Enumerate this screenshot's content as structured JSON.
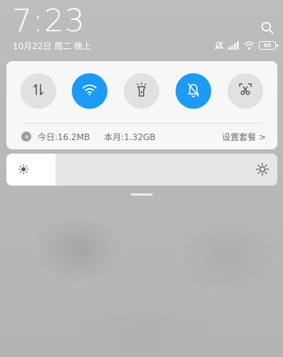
{
  "status": {
    "time": "7:23",
    "date": "10月22日 周二 晚上",
    "battery": "69",
    "icons": [
      "search-icon",
      "do-not-disturb-icon",
      "cellular-signal-icon",
      "wifi-icon",
      "battery-icon"
    ]
  },
  "quick_toggles": [
    {
      "name": "mobile-data",
      "icon": "mobile-data-icon",
      "active": false
    },
    {
      "name": "wifi",
      "icon": "wifi-icon",
      "active": true
    },
    {
      "name": "flashlight",
      "icon": "flashlight-icon",
      "active": false
    },
    {
      "name": "silent-mode",
      "icon": "bell-mute-icon",
      "active": true
    },
    {
      "name": "screenshot",
      "icon": "scissors-icon",
      "active": false
    }
  ],
  "data_usage": {
    "today": "今日:16.2MB",
    "month": "本月:1.32GB",
    "settings_link": "设置套餐 >"
  },
  "brightness": {
    "level": 0.18,
    "icons": [
      "brightness-low-icon",
      "brightness-high-icon"
    ]
  },
  "colors": {
    "accent": "#1a9cf6",
    "panel": "#f7f7f7",
    "toggle_off": "#e1e1e1",
    "backdrop": "#b9b9b9"
  }
}
